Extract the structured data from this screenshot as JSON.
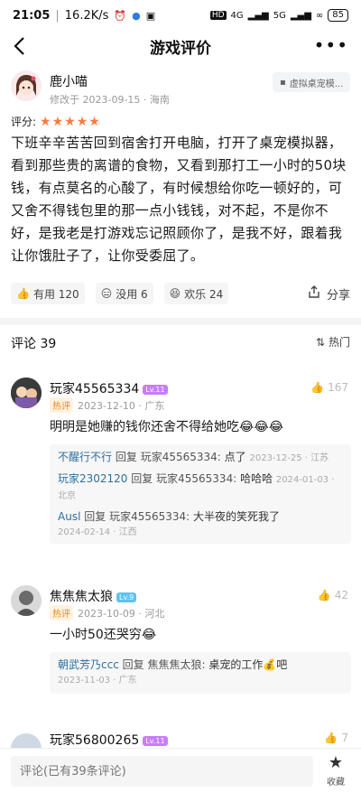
{
  "status_bar": {
    "time": "21:05",
    "speed": "16.2K/s",
    "hd": "HD",
    "net1": "4G",
    "net2": "5G",
    "battery": "85"
  },
  "nav": {
    "back_icon": "chevron-left",
    "title": "游戏评价",
    "more_icon": "more-dots"
  },
  "review": {
    "author": "鹿小喵",
    "meta": "修改于 2023-09-15 · 海南",
    "game_tag": "虚拟桌宠模...",
    "rating_label": "评分:",
    "rating": 5,
    "stars": "★★★★★",
    "body": "下班辛辛苦苦回到宿舍打开电脑，打开了桌宠模拟器，看到那些贵的离谱的食物，又看到那打工一小时的50块钱，有点莫名的心酸了，有时候想给你吃一顿好的，可又舍不得钱包里的那一点小钱钱，对不起，不是你不好，是我老是打游戏忘记照顾你了，是我不好，跟着我让你饿肚子了，让你受委屈了。",
    "actions": {
      "useful": "有用 120",
      "useless": "没用 6",
      "funny": "欢乐 24",
      "share": "分享"
    }
  },
  "comments_header": {
    "title": "评论 39",
    "sort": "热门"
  },
  "comments": [
    {
      "name": "玩家45565334",
      "level": "Lv.11",
      "level_color": "#c77dff",
      "badge": "热评",
      "meta": "2023-12-10 · 广东",
      "likes": "167",
      "text": "明明是她赚的钱你还舍不得给她吃😂😂😂",
      "replies": [
        {
          "name": "不醒行不行",
          "verb": "回复",
          "target": "玩家45565334:",
          "text": "点了",
          "meta": "2023-12-25 · 江苏"
        },
        {
          "name": "玩家2302120",
          "verb": "回复",
          "target": "玩家45565334:",
          "text": "哈哈哈",
          "meta": "2024-01-03 · 北京"
        },
        {
          "name": "Ausl",
          "verb": "回复",
          "target": "玩家45565334:",
          "text": "大半夜的笑死我了",
          "meta": "2024-02-14 · 江西"
        }
      ]
    },
    {
      "name": "焦焦焦太狼",
      "level": "Lv.9",
      "level_color": "#5ec2f0",
      "badge": "热评",
      "meta": "2023-10-09 · 河北",
      "likes": "42",
      "text": "一小时50还哭穷😂",
      "replies": [
        {
          "name": "朝武芳乃ccc",
          "verb": "回复",
          "target": "焦焦焦太狼:",
          "text": "桌宠的工作💰吧",
          "meta": "2023-11-03 · 广东"
        }
      ]
    },
    {
      "name": "玩家56800265",
      "level": "Lv.11",
      "level_color": "#c77dff",
      "likes": "7"
    }
  ],
  "bottom": {
    "placeholder": "评论(已有39条评论)",
    "fav_label": "收藏"
  }
}
